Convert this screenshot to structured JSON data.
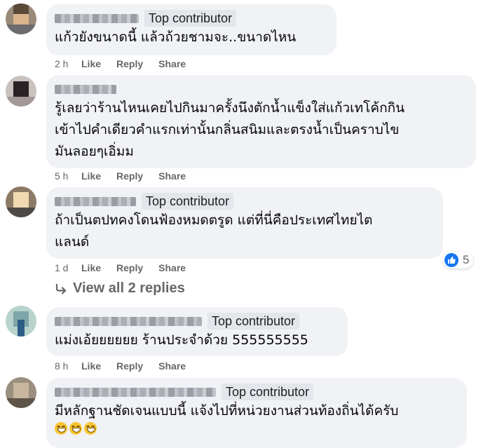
{
  "comments": [
    {
      "badge": "Top contributor",
      "text": "แก้วยังขนาดนี้ แล้วถ้วยชามจะ..ขนาดไหน",
      "time": "2 h",
      "like": "Like",
      "reply": "Reply",
      "share": "Share"
    },
    {
      "badge": "",
      "text": "รู้เลยว่าร้านไหนเคยไปกินมาครั้งนึงตักน้ำแข็งใส่แก้วเทโค้กกิน\nเข้าไปคำเดียวคำแรกเท่านั้นกลิ่นสนิมและตรงน้ำเป็นคราบไข\nมันลอยๆเอิ่มม",
      "time": "5 h",
      "like": "Like",
      "reply": "Reply",
      "share": "Share"
    },
    {
      "badge": "Top contributor",
      "text": "ถ้าเป็นตปทคงโดนฟ้องหมดตรูด แต่ที่นี่คือประเทศไทยไต\nแลนด์",
      "time": "1 d",
      "like": "Like",
      "reply": "Reply",
      "share": "Share",
      "reaction_count": "5"
    },
    {
      "badge": "Top contributor",
      "text": "แม่งเอ้ยยยยยย ร้านประจำด้วย 555555555",
      "time": "8 h",
      "like": "Like",
      "reply": "Reply",
      "share": "Share"
    },
    {
      "badge": "Top contributor",
      "text": "มีหลักฐานชัดเจนแบบนี้ แจ้งไปที่หน่วยงานส่วนท้องถิ่นได้ครับ"
    }
  ],
  "view_replies": "View all 2 replies",
  "colors": {
    "accent": "#1877f2",
    "bubble": "#f0f2f5",
    "meta": "#65676b"
  }
}
